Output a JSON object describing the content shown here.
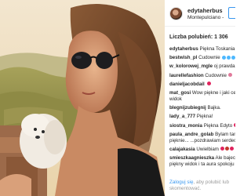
{
  "post": {
    "username": "edytaherbus",
    "location": "Montepulciano -",
    "likes_text": "Liczba polubień: 1 306"
  },
  "comments": [
    {
      "user": "edytaherbus",
      "text": "Piękna Toskania",
      "text2": "",
      "emoji_colors": [
        "#d4a017",
        "#d4a017",
        "#d4a017",
        "#8b5a2b",
        "#c0392b",
        "#c0392b"
      ]
    },
    {
      "user": "bestwish_pl",
      "text": "Cudownie",
      "text2": "",
      "emoji_colors": [
        "#4db8ff",
        "#4db8ff",
        "#4db8ff"
      ]
    },
    {
      "user": "w_kolorowej_mgle",
      "text": "oj prawda",
      "text2": "",
      "emoji_colors": []
    },
    {
      "user": "laurellefashion",
      "text": "Cudownie",
      "text2": "",
      "emoji_colors": [
        "#e07a9b"
      ]
    },
    {
      "user": "danieljacobdail",
      "text": "",
      "text2": "",
      "emoji_colors": [
        "#e0245e"
      ]
    },
    {
      "user": "mat_gosi",
      "text": "Wow piękne i jaki ce",
      "text2": "widok",
      "emoji_colors": [
        "#f0b400",
        "#f0b400",
        "#f0b400",
        "#f0b400",
        "#f0b400"
      ]
    },
    {
      "user": "blegnijzubiegnij",
      "text": "Bajka.",
      "text2": "",
      "emoji_colors": []
    },
    {
      "user": "lady_a_777",
      "text": "Piękna!",
      "text2": "",
      "emoji_colors": []
    },
    {
      "user": "siostra_monia",
      "text": "Piękna Edyto",
      "text2": "",
      "emoji_colors": [
        "#e0245e"
      ]
    },
    {
      "user": "paula_andre_golab",
      "text": "Bylam tam",
      "text2": "pięknie... ...pozdrawiam serdeczn",
      "emoji_colors": []
    },
    {
      "user": "calajakasia",
      "text": "Uwielbiam",
      "text2": "",
      "emoji_colors": [
        "#e0245e",
        "#c0392b",
        "#e0245e"
      ]
    },
    {
      "user": "smieszkaagnieszka",
      "text": "Ale bajecz",
      "text2": "piękny widok i ta aura spokoju",
      "emoji_colors": []
    }
  ],
  "footer": {
    "login_link": "Zaloguj się",
    "rest": ", aby polubić lub",
    "rest2": "skomentować."
  }
}
